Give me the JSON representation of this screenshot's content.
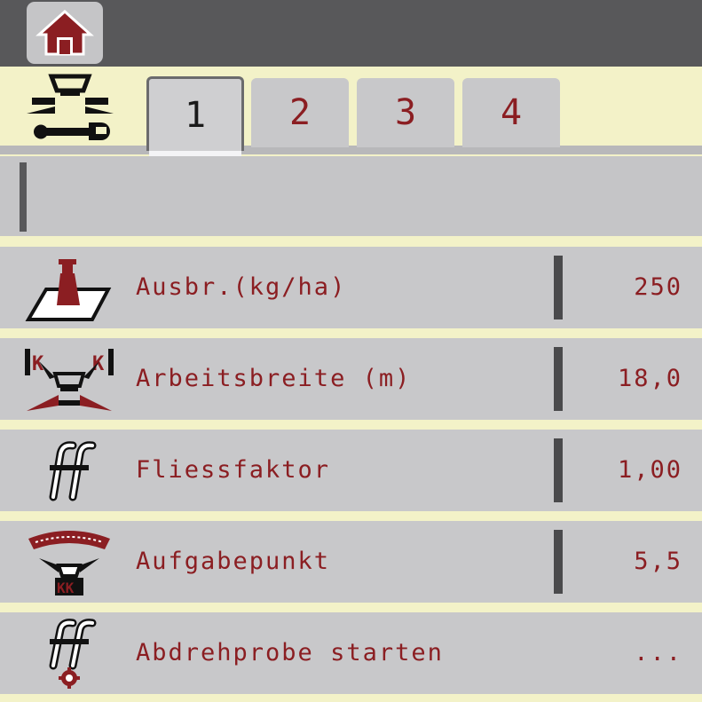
{
  "header": {
    "home_icon": "home-icon",
    "mode_icon": "spreader-wrench-icon"
  },
  "tabs": [
    {
      "label": "1",
      "active": true
    },
    {
      "label": "2",
      "active": false
    },
    {
      "label": "3",
      "active": false
    },
    {
      "label": "4",
      "active": false
    }
  ],
  "rows": [
    {
      "label": "Ausbr.(kg/ha)",
      "value": "250",
      "icon": "weight-on-field-icon"
    },
    {
      "label": "Arbeitsbreite (m)",
      "value": "18,0",
      "icon": "working-width-icon"
    },
    {
      "label": "Fliessfaktor",
      "value": "1,00",
      "icon": "flow-factor-icon"
    },
    {
      "label": "Aufgabepunkt",
      "value": "5,5",
      "icon": "drop-point-icon"
    },
    {
      "label": "Abdrehprobe starten",
      "value": "...",
      "icon": "calibration-test-icon"
    }
  ],
  "colors": {
    "accent": "#8b1e22",
    "bar": "#58585a",
    "background": "#f3f2c8",
    "panel": "#c8c8ca"
  }
}
